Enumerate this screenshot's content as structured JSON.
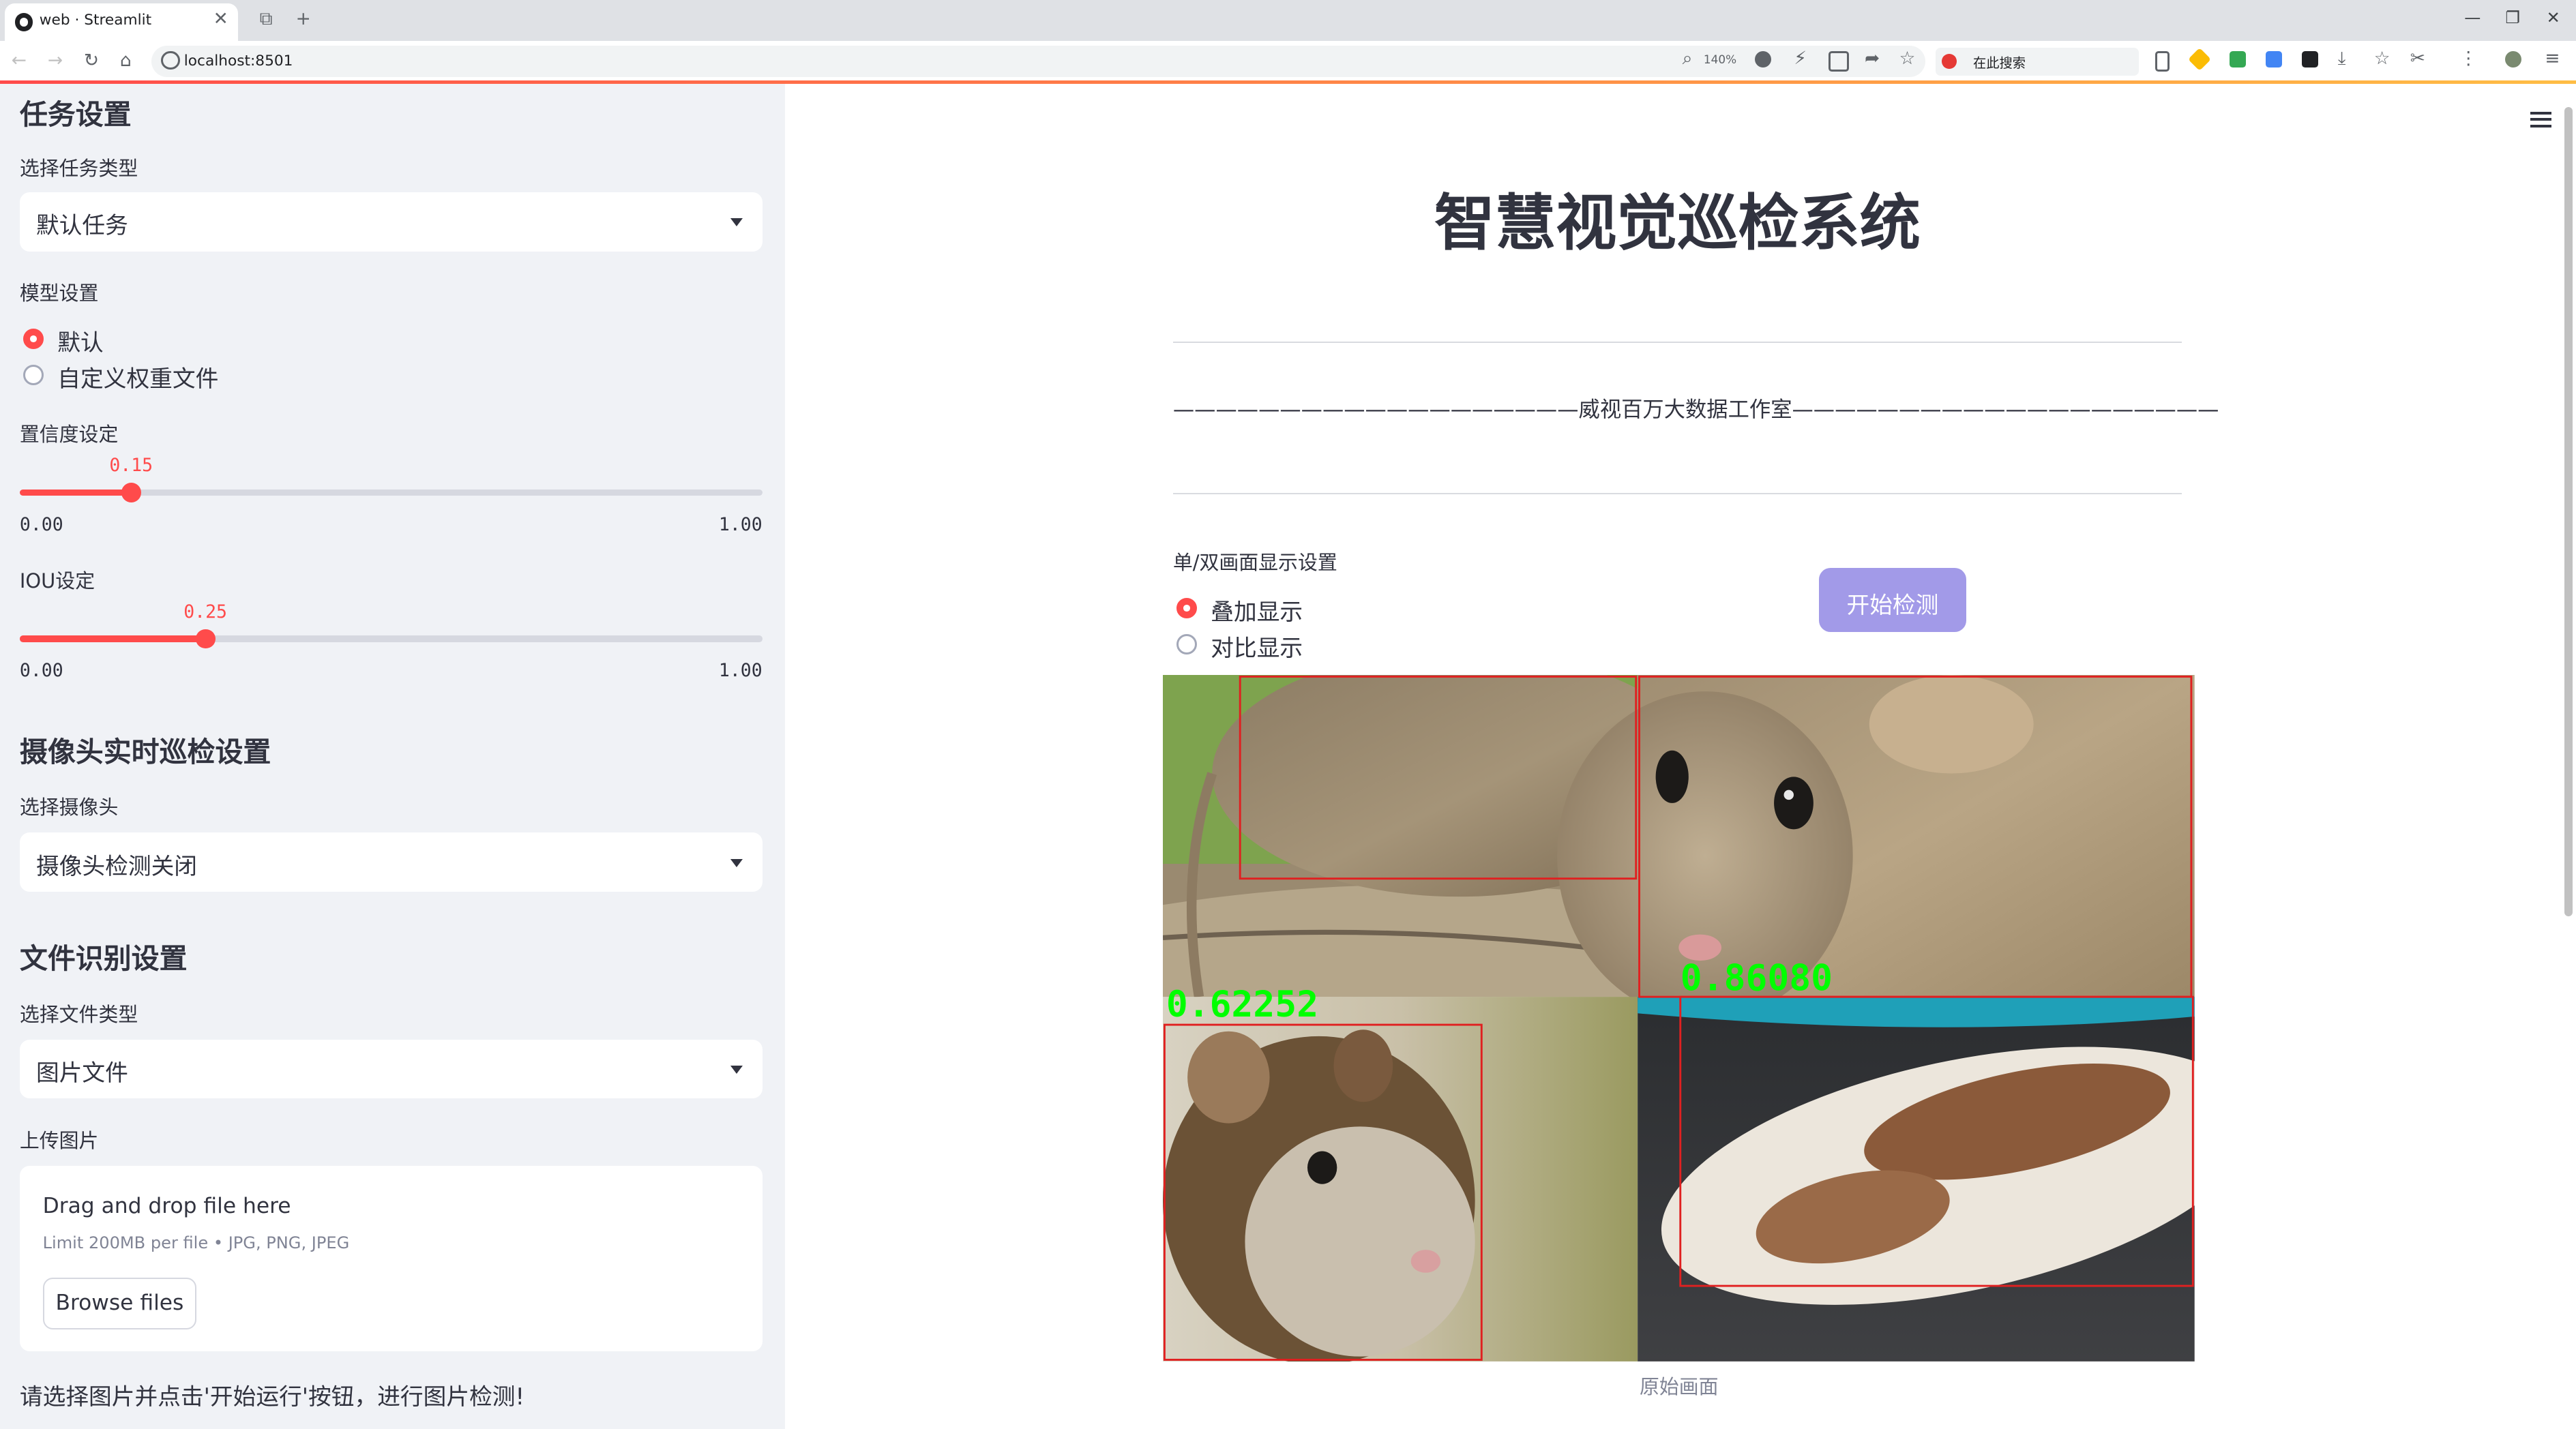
{
  "browser": {
    "tab_title": "web · Streamlit",
    "url": "localhost:8501",
    "zoom": "140%",
    "search_placeholder": "在此搜索"
  },
  "sidebar": {
    "task_header": "任务设置",
    "task_type_label": "选择任务类型",
    "task_type_value": "默认任务",
    "model_label": "模型设置",
    "model_options": [
      "默认",
      "自定义权重文件"
    ],
    "model_selected": 0,
    "conf_label": "置信度设定",
    "conf_value": "0.15",
    "conf_fraction": 0.15,
    "conf_min": "0.00",
    "conf_max": "1.00",
    "iou_label": "IOU设定",
    "iou_value": "0.25",
    "iou_fraction": 0.25,
    "iou_min": "0.00",
    "iou_max": "1.00",
    "camera_header": "摄像头实时巡检设置",
    "camera_label": "选择摄像头",
    "camera_value": "摄像头检测关闭",
    "file_header": "文件识别设置",
    "file_type_label": "选择文件类型",
    "file_type_value": "图片文件",
    "upload_label": "上传图片",
    "upload_title": "Drag and drop file here",
    "upload_limit": "Limit 200MB per file • JPG, PNG, JPEG",
    "browse_label": "Browse files",
    "hint": "请选择图片并点击'开始运行'按钮，进行图片检测!"
  },
  "main": {
    "title": "智慧视觉巡检系统",
    "studio_line": "———————————————————威视百万大数据工作室————————————————————",
    "display_label": "单/双画面显示设置",
    "display_options": [
      "叠加显示",
      "对比显示"
    ],
    "display_selected": 0,
    "start_button": "开始检测",
    "detections": [
      "0.62252",
      "0.86080"
    ],
    "caption": "原始画面"
  },
  "colors": {
    "accent": "#ff4b4b",
    "button": "#a29ae8",
    "sidebar_bg": "#f0f2f6",
    "detection_text": "#00ff00",
    "box": "#e02020"
  }
}
